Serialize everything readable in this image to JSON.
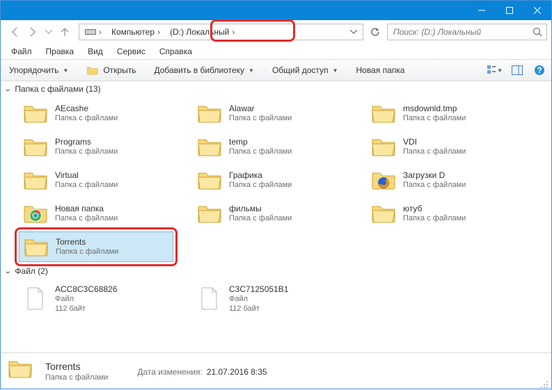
{
  "titlebar": {
    "minimize": "—",
    "maximize": "▢",
    "close": "✕"
  },
  "nav": {
    "back": "←",
    "forward": "→",
    "up": "↑"
  },
  "path": {
    "seg_computer": "Компьютер",
    "seg_drive": "(D:) Локальный"
  },
  "search": {
    "placeholder": "Поиск: (D:) Локальный"
  },
  "menu": {
    "file": "Файл",
    "edit": "Правка",
    "view": "Вид",
    "tools": "Сервис",
    "help": "Справка"
  },
  "toolbar": {
    "organize": "Упорядочить",
    "open": "Открыть",
    "add_lib": "Добавить в библиотеку",
    "share": "Общий доступ",
    "new_folder": "Новая папка"
  },
  "groups": {
    "folders_header": "Папка с файлами (13)",
    "files_header": "Файл (2)"
  },
  "subtype": {
    "folder": "Папка с файлами",
    "file": "Файл",
    "file_size": "112 байт"
  },
  "folders": [
    {
      "name": "AEcashe"
    },
    {
      "name": "Alawar"
    },
    {
      "name": "msdownld.tmp"
    },
    {
      "name": "Programs"
    },
    {
      "name": "temp"
    },
    {
      "name": "VDI"
    },
    {
      "name": "Virtual"
    },
    {
      "name": "Графика"
    },
    {
      "name": "Загрузки D"
    },
    {
      "name": "Новая папка"
    },
    {
      "name": "фильмы"
    },
    {
      "name": "ютуб"
    },
    {
      "name": "Torrents"
    }
  ],
  "files": [
    {
      "name": "ACC8C3C68826"
    },
    {
      "name": "C3C7125051B1"
    }
  ],
  "details": {
    "name": "Torrents",
    "type": "Папка с файлами",
    "date_key": "Дата изменения:",
    "date_val": "21.07.2016 8:35"
  }
}
